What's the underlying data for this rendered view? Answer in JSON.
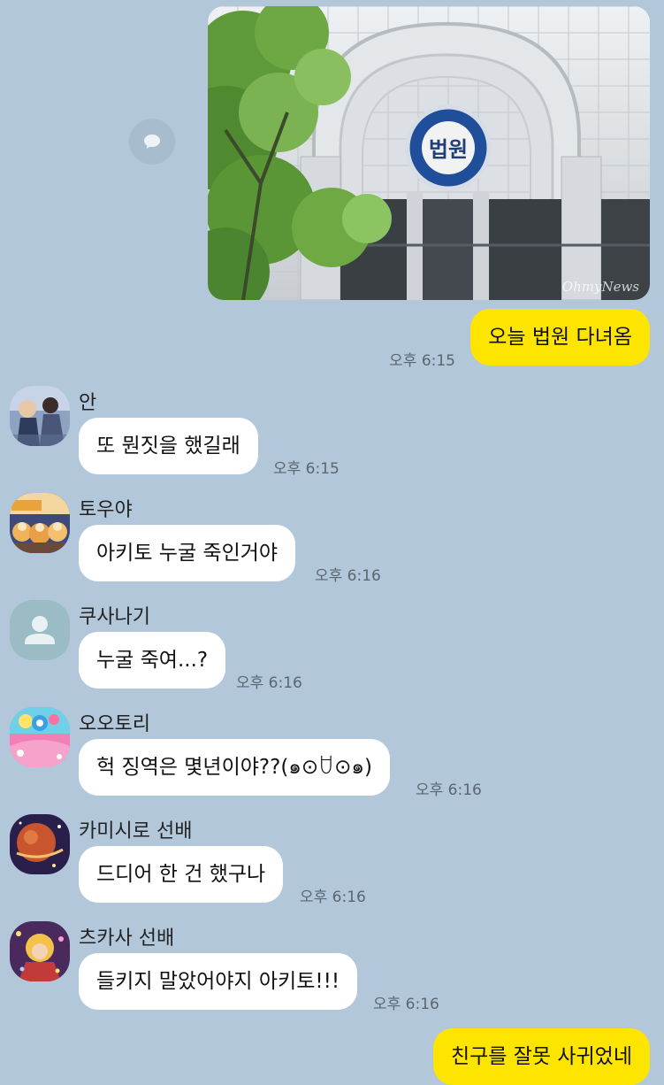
{
  "colors": {
    "background": "#b2c7d9",
    "incoming_bubble": "#ffffff",
    "outgoing_bubble": "#fee500",
    "timestamp": "#5b6670"
  },
  "image_message": {
    "sign_text": "법원",
    "watermark": "OhmyNews",
    "share_icon": "chat-bubble-icon"
  },
  "messages": [
    {
      "side": "out",
      "text": "오늘 법원 다녀옴",
      "time": "오후 6:15"
    },
    {
      "side": "in",
      "sender": "안",
      "text": "또 뭔짓을 했길래",
      "time": "오후 6:15"
    },
    {
      "side": "in",
      "sender": "토우야",
      "text": "아키토 누굴 죽인거야",
      "time": "오후 6:16"
    },
    {
      "side": "in",
      "sender": "쿠사나기",
      "text": "누굴 죽여...?",
      "time": "오후 6:16"
    },
    {
      "side": "in",
      "sender": "오오토리",
      "text": "헉 징역은 몇년이야??(๑⊙ꇴ⊙๑)",
      "time": "오후 6:16"
    },
    {
      "side": "in",
      "sender": "카미시로 선배",
      "text": "드디어 한 건 했구나",
      "time": "오후 6:16"
    },
    {
      "side": "in",
      "sender": "츠카사 선배",
      "text": "들키지 말았어야지 아키토!!!",
      "time": "오후 6:16"
    },
    {
      "side": "out",
      "text": "친구를 잘못 사귀었네",
      "time": ""
    }
  ]
}
